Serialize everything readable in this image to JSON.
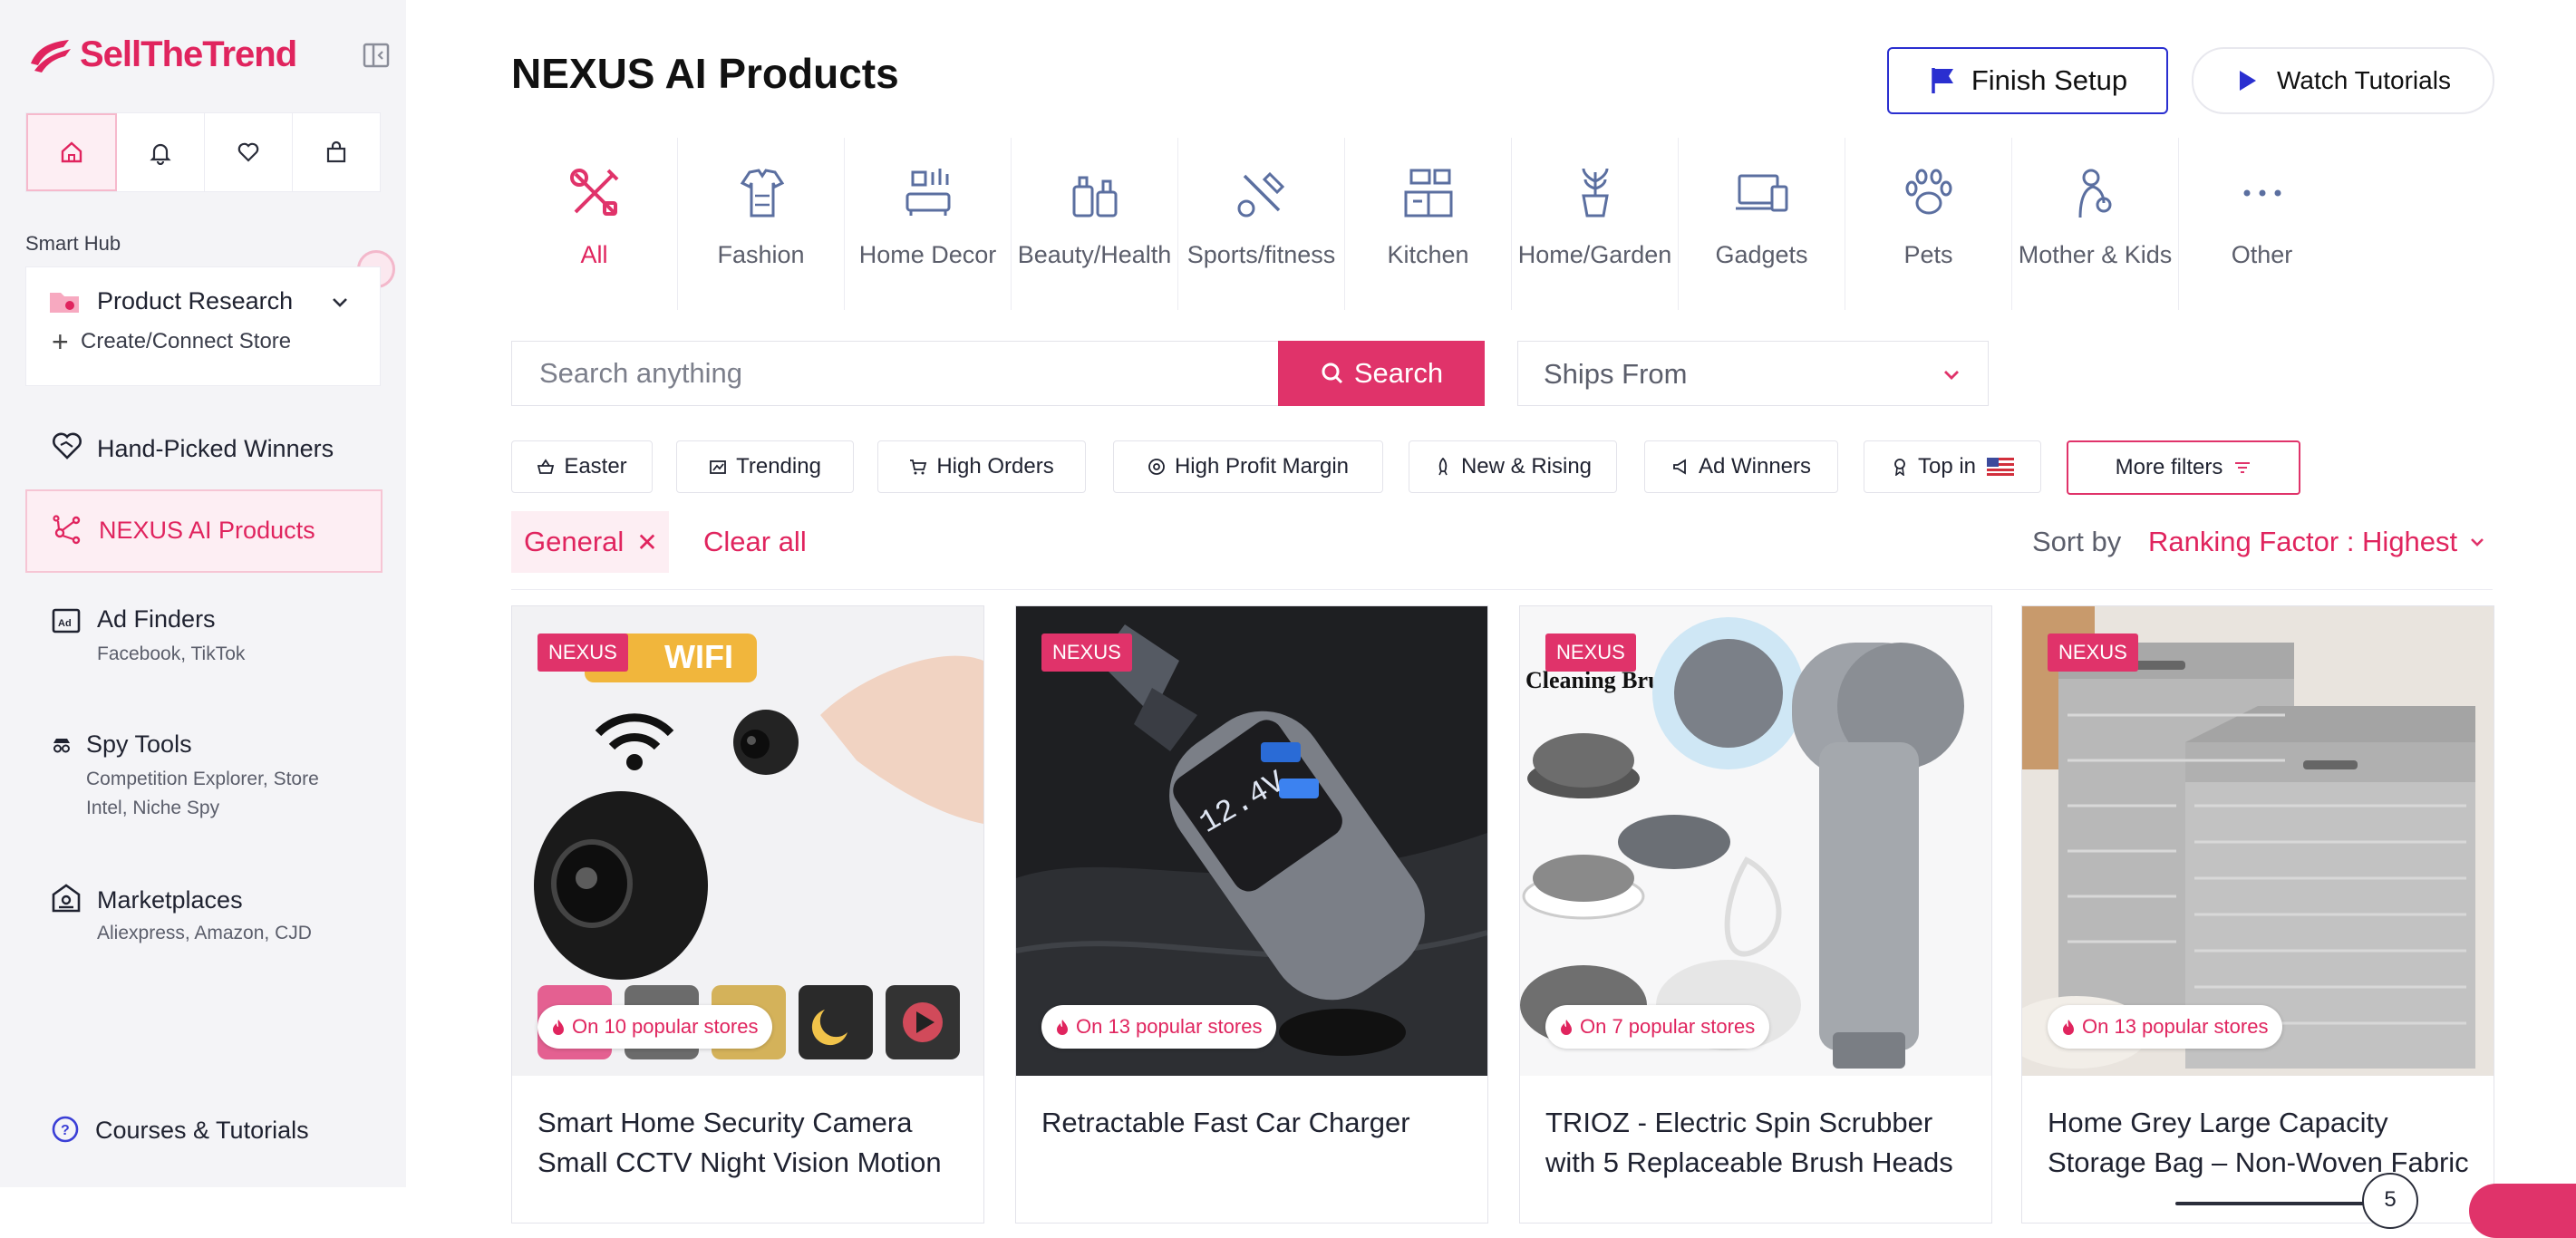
{
  "brand": {
    "name": "SellTheTrend",
    "accent": "#e0245e"
  },
  "sidebar": {
    "smart_hub_label": "Smart Hub",
    "quick_actions": [
      "home-icon",
      "bell-icon",
      "heart-icon",
      "shopping-bag-icon"
    ],
    "product_research": {
      "title": "Product Research",
      "sub": "Create/Connect Store"
    },
    "items": [
      {
        "title": "Hand-Picked Winners",
        "sub": ""
      },
      {
        "title": "NEXUS AI Products",
        "sub": ""
      },
      {
        "title": "Ad Finders",
        "sub": "Facebook, TikTok"
      },
      {
        "title": "Spy Tools",
        "sub_line1": "Competition Explorer, Store",
        "sub_line2": "Intel, Niche Spy"
      },
      {
        "title": "Marketplaces",
        "sub": "Aliexpress, Amazon, CJD"
      },
      {
        "title": "Courses & Tutorials",
        "sub": ""
      }
    ]
  },
  "header": {
    "title": "NEXUS AI Products",
    "finish_setup": "Finish Setup",
    "watch_tutorials": "Watch Tutorials"
  },
  "categories": [
    {
      "label": "All",
      "icon": "tools-icon",
      "active": true
    },
    {
      "label": "Fashion",
      "icon": "clothing-icon"
    },
    {
      "label": "Home Decor",
      "icon": "living-room-icon"
    },
    {
      "label": "Beauty/Health",
      "icon": "cosmetics-icon"
    },
    {
      "label": "Sports/fitness",
      "icon": "sports-icon"
    },
    {
      "label": "Kitchen",
      "icon": "kitchen-icon"
    },
    {
      "label": "Home/Garden",
      "icon": "plant-icon"
    },
    {
      "label": "Gadgets",
      "icon": "devices-icon"
    },
    {
      "label": "Pets",
      "icon": "paw-icon"
    },
    {
      "label": "Mother & Kids",
      "icon": "mother-child-icon"
    },
    {
      "label": "Other",
      "icon": "more-icon"
    }
  ],
  "search": {
    "placeholder": "Search anything",
    "button": "Search",
    "ships_from": "Ships From"
  },
  "chips": {
    "easter": "Easter",
    "trending": "Trending",
    "high_orders": "High Orders",
    "high_profit": "High Profit Margin",
    "new_rising": "New & Rising",
    "ad_winners": "Ad Winners",
    "top_in": "Top in",
    "more_filters": "More filters"
  },
  "active_filter": {
    "tag": "General",
    "clear": "Clear all"
  },
  "sort": {
    "label": "Sort by",
    "value": "Ranking Factor : Highest"
  },
  "products": [
    {
      "badge": "NEXUS",
      "stores": "On 10 popular stores",
      "name": "Smart Home Security Camera Small CCTV Night Vision Motion",
      "img_text": "WIFI"
    },
    {
      "badge": "NEXUS",
      "stores": "On 13 popular stores",
      "name": "Retractable Fast Car Charger"
    },
    {
      "badge": "NEXUS",
      "stores": "On 7 popular stores",
      "name": "TRIOZ - Electric Spin Scrubber with 5 Replaceable Brush Heads",
      "img_text": "Cleaning Brush"
    },
    {
      "badge": "NEXUS",
      "stores": "On 13 popular stores",
      "name": "Home Grey Large Capacity Storage Bag – Non-Woven Fabric"
    }
  ],
  "pager": {
    "value": "5"
  }
}
